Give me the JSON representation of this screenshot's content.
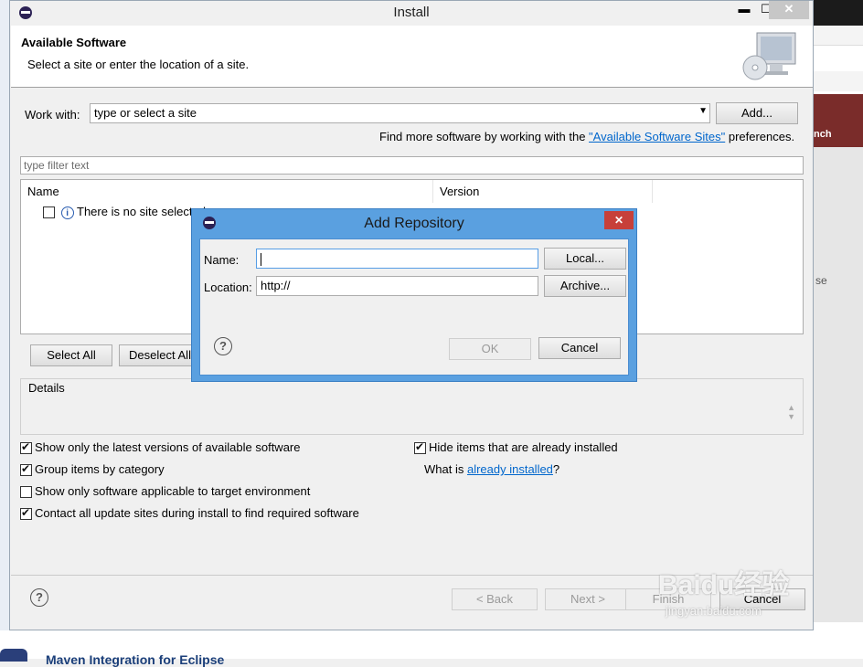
{
  "window": {
    "title": "Install",
    "minimize_glyph": "▬",
    "maximize_glyph": "☐",
    "close_glyph": "✕"
  },
  "header": {
    "title": "Available Software",
    "subtitle": "Select a site or enter the location of a site."
  },
  "work_with": {
    "label": "Work with:",
    "value": "type or select a site",
    "add_button": "Add...",
    "find_more_prefix": "Find more software by working with the ",
    "find_more_link": "\"Available Software Sites\"",
    "find_more_suffix": " preferences."
  },
  "filter": {
    "placeholder": "type filter text"
  },
  "table": {
    "columns": [
      "Name",
      "Version"
    ],
    "rows": [
      {
        "text": "There is no site selected.",
        "checked": false
      }
    ]
  },
  "buttons": {
    "select_all": "Select All",
    "deselect_all": "Deselect All"
  },
  "details": {
    "label": "Details"
  },
  "options": {
    "latest_only": {
      "label": "Show only the latest versions of available software",
      "checked": true
    },
    "group_by_category": {
      "label": "Group items by category",
      "checked": true
    },
    "target_env_only": {
      "label": "Show only software applicable to target environment",
      "checked": false
    },
    "contact_all_sites": {
      "label": "Contact all update sites during install to find required software",
      "checked": true
    },
    "hide_installed": {
      "label": "Hide items that are already installed",
      "checked": true
    },
    "what_is_prefix": "What is ",
    "what_is_link": "already installed",
    "what_is_suffix": "?"
  },
  "footer": {
    "back": "< Back",
    "next": "Next >",
    "finish": "Finish",
    "cancel": "Cancel"
  },
  "dialog": {
    "title": "Add Repository",
    "name_label": "Name:",
    "name_value": "",
    "location_label": "Location:",
    "location_value": "http://",
    "local_button": "Local...",
    "archive_button": "Archive...",
    "ok_button": "OK",
    "cancel_button": "Cancel",
    "close_glyph": "✕"
  },
  "background": {
    "right_panel_text": "nch",
    "right_panel_side_text": "se",
    "bottom_text": "Maven Integration for Eclipse"
  },
  "watermark": {
    "brand": "Baidu经验",
    "url": "jingyan.baidu.com"
  }
}
